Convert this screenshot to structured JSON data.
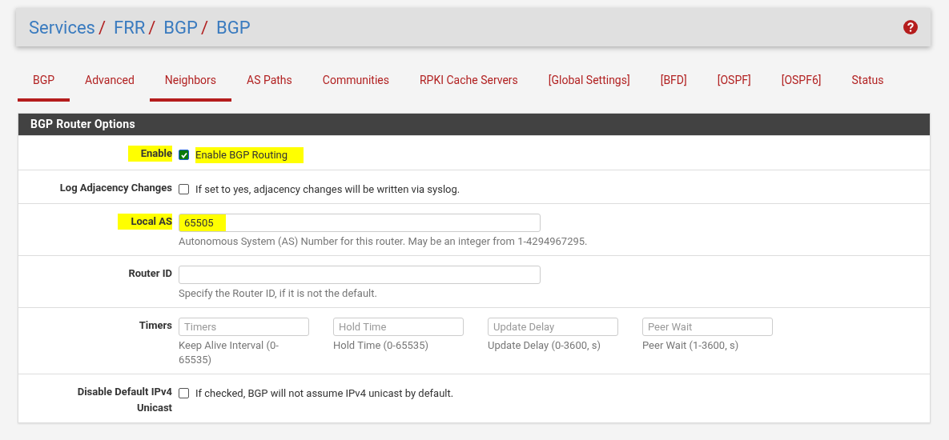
{
  "breadcrumb": {
    "separator": "/",
    "items": [
      "Services",
      "FRR",
      "BGP",
      "BGP"
    ]
  },
  "tabs": [
    {
      "label": "BGP",
      "selected": true
    },
    {
      "label": "Advanced",
      "selected": false
    },
    {
      "label": "Neighbors",
      "selected": true
    },
    {
      "label": "AS Paths",
      "selected": false
    },
    {
      "label": "Communities",
      "selected": false
    },
    {
      "label": "RPKI Cache Servers",
      "selected": false
    },
    {
      "label": "[Global Settings]",
      "selected": false
    },
    {
      "label": "[BFD]",
      "selected": false
    },
    {
      "label": "[OSPF]",
      "selected": false
    },
    {
      "label": "[OSPF6]",
      "selected": false
    },
    {
      "label": "Status",
      "selected": false
    }
  ],
  "panel": {
    "title": "BGP Router Options",
    "rows": [
      {
        "kind": "checkbox",
        "label": "Enable",
        "highlighted": true,
        "checked": true,
        "text": "Enable BGP Routing"
      },
      {
        "kind": "checkbox",
        "label": "Log Adjacency Changes",
        "highlighted": false,
        "checked": false,
        "text": "If set to yes, adjacency changes will be written via syslog."
      },
      {
        "kind": "text",
        "label": "Local AS",
        "highlighted": true,
        "value": "65505",
        "help": "Autonomous System (AS) Number for this router. May be an integer from 1-4294967295."
      },
      {
        "kind": "text",
        "label": "Router ID",
        "highlighted": false,
        "help": "Specify the Router ID, if it is not the default."
      },
      {
        "kind": "group",
        "label": "Timers",
        "highlighted": false,
        "fields": [
          {
            "placeholder": "Timers",
            "help": "Keep Alive Interval (0-65535)"
          },
          {
            "placeholder": "Hold Time",
            "help": "Hold Time (0-65535)"
          },
          {
            "placeholder": "Update Delay",
            "help": "Update Delay (0-3600, s)"
          },
          {
            "placeholder": "Peer Wait",
            "help": "Peer Wait (1-3600, s)"
          }
        ]
      },
      {
        "kind": "checkbox",
        "label": "Disable Default IPv4 Unicast",
        "highlighted": false,
        "checked": false,
        "text": "If checked, BGP will not assume IPv4 unicast by default."
      }
    ]
  }
}
